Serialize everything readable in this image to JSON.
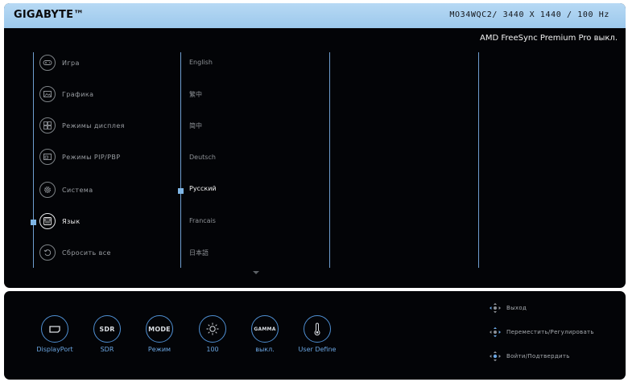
{
  "header": {
    "brand": "GIGABYTE™",
    "model_info": "MO34WQC2/ 3440 X 1440 / 100 Hz"
  },
  "status": {
    "freesync": "AMD FreeSync Premium Pro выкл."
  },
  "menu": {
    "items": [
      {
        "label": "Игра",
        "icon": "gamepad-icon"
      },
      {
        "label": "Графика",
        "icon": "picture-icon"
      },
      {
        "label": "Режимы дисплея",
        "icon": "display-mode-icon"
      },
      {
        "label": "Режимы PIP/PBP",
        "icon": "pip-icon"
      },
      {
        "label": "Система",
        "icon": "gear-icon"
      },
      {
        "label": "Язык",
        "icon": "language-icon"
      },
      {
        "label": "Сбросить все",
        "icon": "reset-icon"
      }
    ],
    "active_index": 5
  },
  "languages": {
    "items": [
      "English",
      "繁中",
      "简中",
      "Deutsch",
      "Русский",
      "Francais",
      "日本語"
    ],
    "selected": "Русский"
  },
  "hotkeys": [
    {
      "label": "DisplayPort",
      "icon": "displayport-icon"
    },
    {
      "label": "SDR",
      "icon_text": "SDR"
    },
    {
      "label": "Режим",
      "icon_text": "MODE"
    },
    {
      "label": "100",
      "icon": "brightness-icon"
    },
    {
      "label": "выкл.",
      "icon_text": "GAMMA"
    },
    {
      "label": "User Define",
      "icon": "thermometer-icon"
    }
  ],
  "help": [
    {
      "label": "Выход",
      "icon": "joystick-left-icon"
    },
    {
      "label": "Переместить/Регулировать",
      "icon": "joystick-updown-icon"
    },
    {
      "label": "Войти/Подтвердить",
      "icon": "joystick-press-icon"
    }
  ],
  "colors": {
    "header_bg": "#a9d1f0",
    "panel_bg": "#030407",
    "accent": "#6ba6e2",
    "separator": "#6f9ed0"
  }
}
